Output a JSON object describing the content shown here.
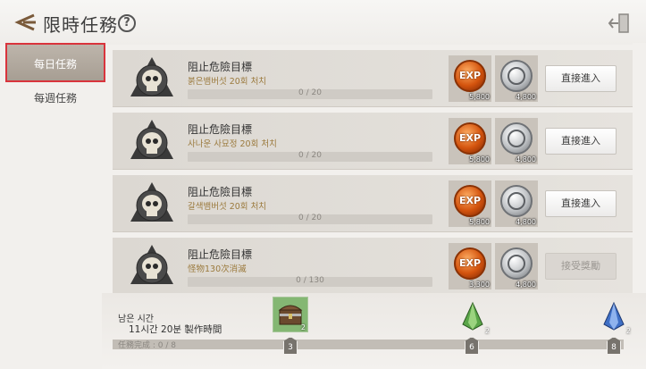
{
  "header": {
    "title": "限時任務",
    "help_glyph": "?"
  },
  "sidebar": {
    "tabs": [
      {
        "label": "每日任務",
        "active": true
      },
      {
        "label": "每週任務",
        "active": false
      }
    ]
  },
  "quests": [
    {
      "title": "阻止危險目標",
      "subtitle": "붉은뱀버섯 20회 처치",
      "progress": "0 / 20",
      "exp_icon": "EXP",
      "exp_amount": "5,800",
      "silver_amount": "4,800",
      "button": "直接進入",
      "button_enabled": true
    },
    {
      "title": "阻止危險目標",
      "subtitle": "사나운 사묘정 20회 처치",
      "progress": "0 / 20",
      "exp_icon": "EXP",
      "exp_amount": "5,800",
      "silver_amount": "4,800",
      "button": "直接進入",
      "button_enabled": true
    },
    {
      "title": "阻止危險目標",
      "subtitle": "갈색뱀버섯 20회 처치",
      "progress": "0 / 20",
      "exp_icon": "EXP",
      "exp_amount": "5,800",
      "silver_amount": "4,800",
      "button": "直接進入",
      "button_enabled": true
    },
    {
      "title": "阻止危險目標",
      "subtitle": "怪物130次消滅",
      "progress": "0 / 130",
      "exp_icon": "EXP",
      "exp_amount": "3,300",
      "silver_amount": "4,800",
      "button": "接受獎勵",
      "button_enabled": false
    }
  ],
  "footer": {
    "remain_label": "남은 시간",
    "remain_time": "11시간 20분 製作時間",
    "mission_progress": "任務完成 : 0 / 8",
    "milestones": [
      {
        "count": "3",
        "reward_qty": "2",
        "icon": "treasure-chest-icon"
      },
      {
        "count": "6",
        "reward_qty": "2",
        "icon": "green-crystal-icon"
      },
      {
        "count": "8",
        "reward_qty": "2",
        "icon": "blue-crystal-icon"
      }
    ]
  },
  "colors": {
    "active_tab_border": "#d9343c",
    "exp_orange": "#d4540e",
    "chest_bg": "#84b773"
  }
}
